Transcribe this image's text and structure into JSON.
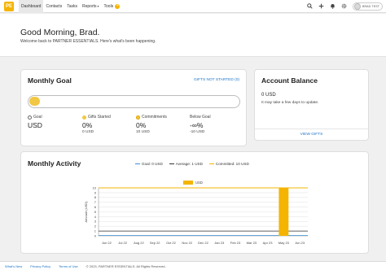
{
  "nav": {
    "logo": "PE",
    "items": [
      {
        "label": "Dashboard",
        "active": true
      },
      {
        "label": "Contacts"
      },
      {
        "label": "Tasks"
      },
      {
        "label": "Reports",
        "dropdown": true
      },
      {
        "label": "Tools",
        "dropdown": true
      }
    ],
    "tools_badge": "+",
    "user_name": "BRAD TEST"
  },
  "greeting": {
    "title": "Good Morning, Brad.",
    "subtitle": "Welcome back to PARTNER ESSENTIALS. Here's what's been happening."
  },
  "monthly_goal": {
    "title": "Monthly Goal",
    "link": "GIFTS NOT STARTED (0)",
    "progress_fraction": 0.0,
    "stats": [
      {
        "label": "Goal",
        "value": "USD",
        "sub": "",
        "dot": "hollow"
      },
      {
        "label": "Gifts Started",
        "value": "0%",
        "sub": "0 USD",
        "dot": "#f2c744"
      },
      {
        "label": "Commitments",
        "value": "0%",
        "sub": "10 USD",
        "dot": "#f2c744"
      },
      {
        "label": "Below Goal",
        "value": "-∞%",
        "sub": "-10 USD",
        "dot": ""
      }
    ]
  },
  "account_balance": {
    "title": "Account Balance",
    "value": "0 USD",
    "note": "It may take a few days to update.",
    "link": "VIEW GIFTS"
  },
  "monthly_activity": {
    "title": "Monthly Activity",
    "legend": [
      {
        "label": "Goal: 0 USD",
        "color": "#3a8fd6"
      },
      {
        "label": "Average: 1 USD",
        "color": "#333333"
      },
      {
        "label": "Committed: 10 USD",
        "color": "#f4b400"
      }
    ]
  },
  "chart_data": {
    "type": "bar",
    "categories": [
      "Jun 22",
      "Jul 22",
      "Aug 22",
      "Sep 22",
      "Oct 22",
      "Nov 22",
      "Dec 22",
      "Jan 23",
      "Feb 23",
      "Mar 23",
      "Apr 23",
      "May 23",
      "Jun 23"
    ],
    "series": [
      {
        "name": "USD",
        "values": [
          0,
          0,
          0,
          0,
          0,
          0,
          0,
          0,
          0,
          0,
          0,
          10,
          0
        ],
        "color": "#f4b400"
      }
    ],
    "reference_lines": {
      "goal": 0,
      "average": 1,
      "committed": 10
    },
    "ylabel": "Amount (USD)",
    "ylim": [
      0,
      10
    ],
    "yticks": [
      0,
      1,
      2,
      3,
      4,
      5,
      6,
      7,
      8,
      9,
      10
    ],
    "grid": true,
    "legend_label": "USD",
    "legend_position": "top-center"
  },
  "footer": {
    "links": [
      "What's New",
      "Privacy Policy",
      "Terms of Use"
    ],
    "copyright": "© 2023, PARTNER ESSENTIALS. All Rights Reserved."
  }
}
